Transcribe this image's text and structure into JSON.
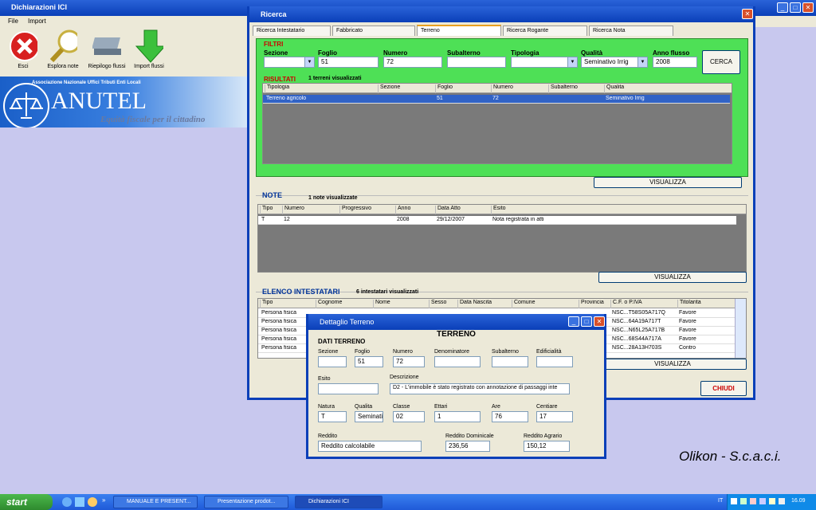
{
  "main": {
    "title": "Dichiarazioni ICI",
    "menu": [
      "File",
      "Import"
    ],
    "toolbar": [
      {
        "label": "Esci",
        "icon": "exit-icon"
      },
      {
        "label": "Esplora note",
        "icon": "magnifier-icon"
      },
      {
        "label": "Riepilogo flussi",
        "icon": "keyboard-icon"
      },
      {
        "label": "Import flussi",
        "icon": "down-arrow-icon"
      }
    ],
    "logo": {
      "association": "Associazione Nazionale Uffici Tributi Enti Locali",
      "name": "ANUTEL",
      "tagline": "Equità fiscale per il cittadino"
    },
    "signature": "Olikon - S.c.a.c.i."
  },
  "ricerca": {
    "title": "Ricerca",
    "tabs": [
      "Ricerca Intestatario",
      "Fabbricato",
      "Terreno",
      "Ricerca Rogante",
      "Ricerca Nota"
    ],
    "filtri": {
      "title": "FILTRI",
      "sezione_label": "Sezione",
      "sezione": "",
      "foglio_label": "Foglio",
      "foglio": "51",
      "numero_label": "Numero",
      "numero": "72",
      "subalterno_label": "Subalterno",
      "subalterno": "",
      "tipologia_label": "Tipologia",
      "tipologia": "",
      "qualita_label": "Qualità",
      "qualita": "Seminativo Irrig",
      "anno_label": "Anno flusso",
      "anno": "2008",
      "cerca": "CERCA"
    },
    "risultati": {
      "title": "RISULTATI",
      "count": "1 terreni visualizzati",
      "headers": [
        "Tipologia",
        "Sezione",
        "Foglio",
        "Numero",
        "Subalterno",
        "Qualita"
      ],
      "rows": [
        [
          "Terreno agricolo",
          "",
          "51",
          "72",
          "",
          "Seminativo Irrig"
        ]
      ],
      "visualizza": "VISUALIZZA"
    },
    "note": {
      "title": "NOTE",
      "count": "1 note visualizzate",
      "headers": [
        "Tipo",
        "Numero",
        "Progressivo",
        "Anno",
        "Data Atto",
        "Esito"
      ],
      "rows": [
        [
          "T",
          "12",
          "",
          "2008",
          "29/12/2007",
          "Nota registrata in atti"
        ]
      ],
      "visualizza": "VISUALIZZA"
    },
    "intestatari": {
      "title": "ELENCO INTESTATARI",
      "count": "6 intestatari visualizzati",
      "headers": [
        "Tipo",
        "Cognome",
        "Nome",
        "Sesso",
        "Data Nascita",
        "Comune",
        "Provincia",
        "C.F. o P.IVA",
        "Titolarita"
      ],
      "rows": [
        [
          "Persona fisica",
          "",
          "",
          "",
          "",
          "",
          "",
          "NSC...T58S05A717Q",
          "Favore"
        ],
        [
          "Persona fisica",
          "",
          "",
          "",
          "",
          "",
          "",
          "NSC...64A19A717T",
          "Favore"
        ],
        [
          "Persona fisica",
          "",
          "",
          "",
          "",
          "",
          "",
          "NSC...N65L25A717B",
          "Favore"
        ],
        [
          "Persona fisica",
          "",
          "",
          "",
          "",
          "",
          "",
          "NSC...68S44A717A",
          "Favore"
        ],
        [
          "Persona fisica",
          "",
          "",
          "",
          "",
          "",
          "",
          "NSC...28A13H703S",
          "Contro"
        ]
      ],
      "visualizza": "VISUALIZZA"
    },
    "chiudi": "CHIUDI"
  },
  "dettaglio": {
    "title": "Dettaglio Terreno",
    "heading": "TERRENO",
    "section": "DATI TERRENO",
    "sezione_label": "Sezione",
    "sezione": "",
    "foglio_label": "Foglio",
    "foglio": "51",
    "numero_label": "Numero",
    "numero": "72",
    "denominatore_label": "Denominatore",
    "denominatore": "",
    "subalterno_label": "Subalterno",
    "subalterno": "",
    "edificialita_label": "Edificialità",
    "edificialita": "",
    "esito_label": "Esito",
    "esito": "",
    "descrizione_label": "Descrizione",
    "descrizione": "D2 - L'immobile è stato registrato con annotazione di passaggi inte",
    "natura_label": "Natura",
    "natura": "T",
    "qualita_label": "Qualita",
    "qualita": "Seminati",
    "classe_label": "Classe",
    "classe": "02",
    "ettari_label": "Ettari",
    "ettari": "1",
    "are_label": "Are",
    "are": "76",
    "centiare_label": "Centiare",
    "centiare": "17",
    "reddito_label": "Reddito",
    "reddito": "Reddito calcolabile",
    "dominicale_label": "Reddito Dominicale",
    "dominicale": "236,56",
    "agrario_label": "Reddito Agrario",
    "agrario": "150,12"
  },
  "taskbar": {
    "start": "start",
    "tasks": [
      "MANUALE E PRESENT...",
      "Presentazione prodot...",
      "Dichiarazioni ICI"
    ],
    "lang": "IT",
    "clock": "16.09"
  }
}
